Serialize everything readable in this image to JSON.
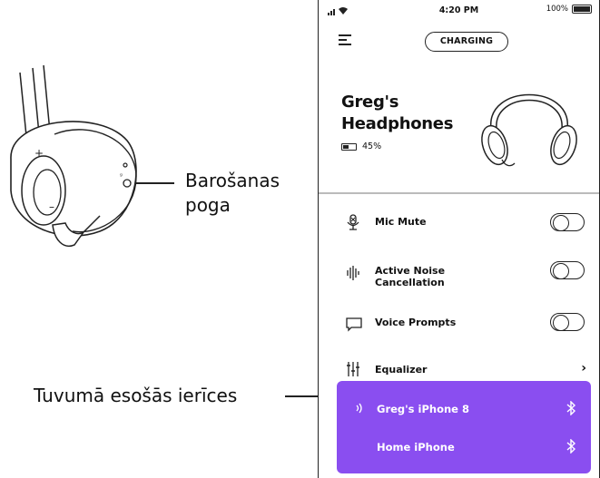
{
  "callouts": {
    "power_button": "Barošanas\npoga",
    "nearby_devices": "Tuvumā esošās ierīces"
  },
  "status_bar": {
    "time": "4:20 PM",
    "battery": "100%"
  },
  "header": {
    "charging_label": "CHARGING"
  },
  "device": {
    "name": "Greg's Headphones",
    "battery_percent": "45%"
  },
  "settings": [
    {
      "label": "Mic Mute",
      "icon": "mic-mute-icon",
      "type": "toggle",
      "on": false
    },
    {
      "label": "Active Noise Cancellation",
      "icon": "noise-cancellation-icon",
      "type": "toggle",
      "on": false
    },
    {
      "label": "Voice Prompts",
      "icon": "voice-prompts-icon",
      "type": "toggle",
      "on": false
    },
    {
      "label": "Equalizer",
      "icon": "equalizer-icon",
      "type": "link"
    }
  ],
  "nearby_devices": [
    {
      "label": "Greg's iPhone 8",
      "connected": true
    },
    {
      "label": "Home iPhone",
      "connected": false
    }
  ],
  "colors": {
    "accent": "#8a4ef0"
  }
}
